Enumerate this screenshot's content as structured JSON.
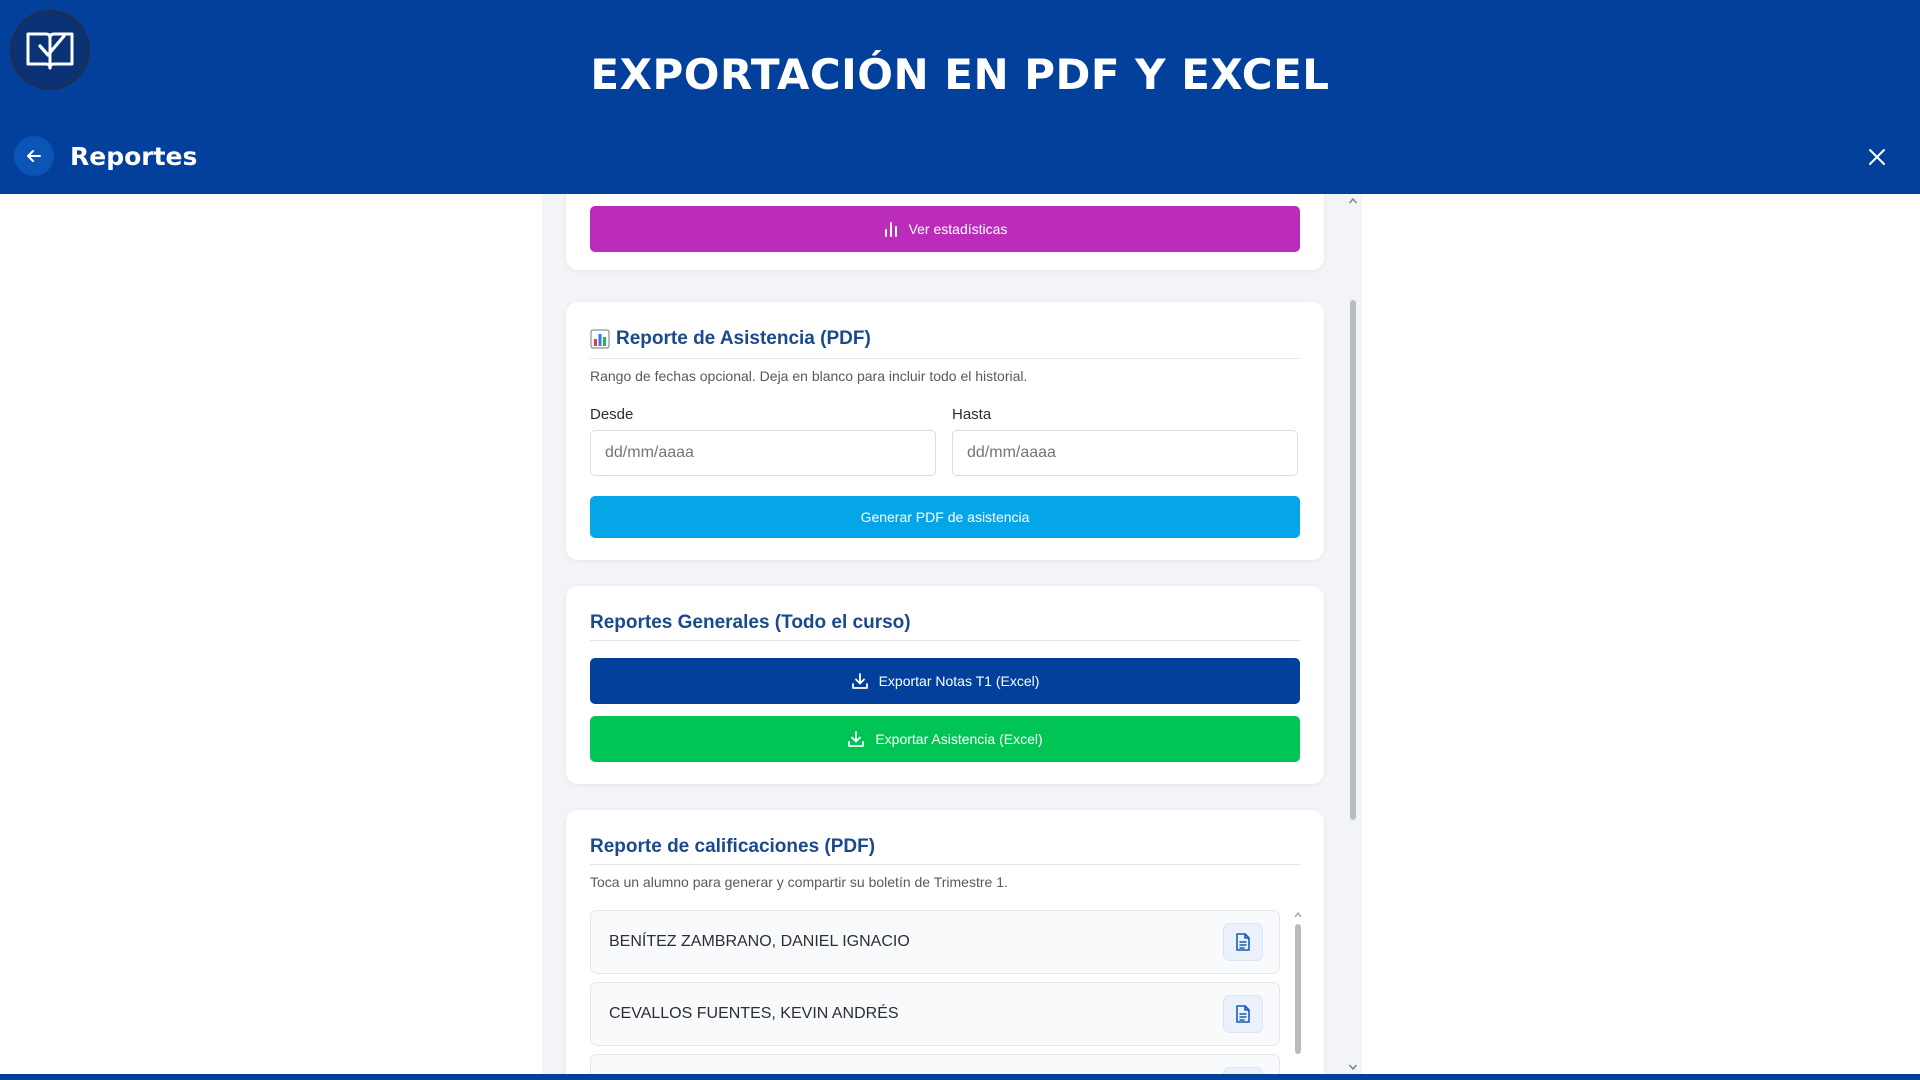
{
  "header": {
    "banner_title": "EXPORTACIÓN EN PDF Y EXCEL",
    "page_title": "Reportes",
    "background_color": "#02409c"
  },
  "stats_card": {
    "button_label": "Ver estadísticas",
    "button_color": "#bb2cba"
  },
  "attendance_card": {
    "title": "Reporte de Asistencia (PDF)",
    "hint": "Rango de fechas opcional. Deja en blanco para incluir todo el historial.",
    "from_label": "Desde",
    "to_label": "Hasta",
    "from_placeholder": "dd/mm/aaaa",
    "to_placeholder": "dd/mm/aaaa",
    "button_label": "Generar PDF de asistencia",
    "button_color": "#04a6e8"
  },
  "general_card": {
    "title": "Reportes Generales (Todo el curso)",
    "export_grades_label": "Exportar Notas T1 (Excel)",
    "export_grades_color": "#02409c",
    "export_attendance_label": "Exportar Asistencia (Excel)",
    "export_attendance_color": "#00c454"
  },
  "grades_card": {
    "title": "Reporte de calificaciones (PDF)",
    "hint": "Toca un alumno para generar y compartir su boletín de Trimestre 1.",
    "students": [
      {
        "name": "BENÍTEZ ZAMBRANO, DANIEL IGNACIO"
      },
      {
        "name": "CEVALLOS FUENTES, KEVIN ANDRÉS"
      },
      {
        "name": ""
      }
    ]
  }
}
